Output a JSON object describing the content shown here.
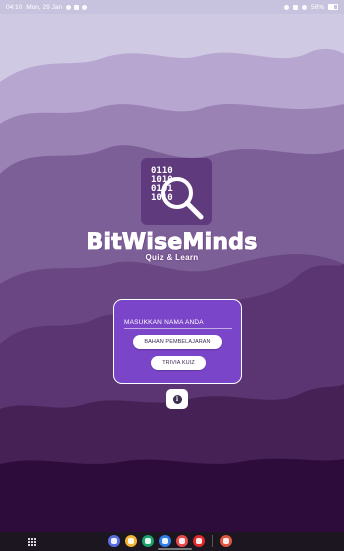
{
  "status_bar": {
    "time": "04:10",
    "date": "Mon, 29 Jan",
    "battery": "58%"
  },
  "logo": {
    "binary_lines": [
      "0110",
      "1010",
      "0101",
      "1010"
    ],
    "brand": "BitWiseMinds",
    "tagline": "Quiz & Learn"
  },
  "name_card": {
    "title": "MASUKKAN NAMA ANDA",
    "button_materials": "BAHAN PEMBELAJARAN",
    "button_quiz": "TRIVIA KUIZ"
  },
  "info_button": {
    "glyph": "i"
  },
  "colors": {
    "sky": "#cfc9e4",
    "wave_1": "#b7a6d0",
    "wave_2": "#9a83b4",
    "wave_3": "#7d5f97",
    "wave_4": "#623e7b",
    "wave_5": "#4a2463",
    "ground": "#2d0b3a",
    "card": "#7a45c8"
  },
  "navbar": {
    "apps": [
      {
        "icon": "messages-app-icon",
        "color": "#5b6ee1"
      },
      {
        "icon": "notes-app-icon",
        "color": "#f2b233"
      },
      {
        "icon": "phone-app-icon",
        "color": "#19a36b"
      },
      {
        "icon": "chrome-app-icon",
        "color": "#2f7ee6"
      },
      {
        "icon": "camera-app-icon",
        "color": "#e84b4b"
      },
      {
        "icon": "youtube-app-icon",
        "color": "#e02a2a"
      },
      {
        "icon": "recent-app-icon",
        "color": "#e0573d"
      }
    ]
  }
}
